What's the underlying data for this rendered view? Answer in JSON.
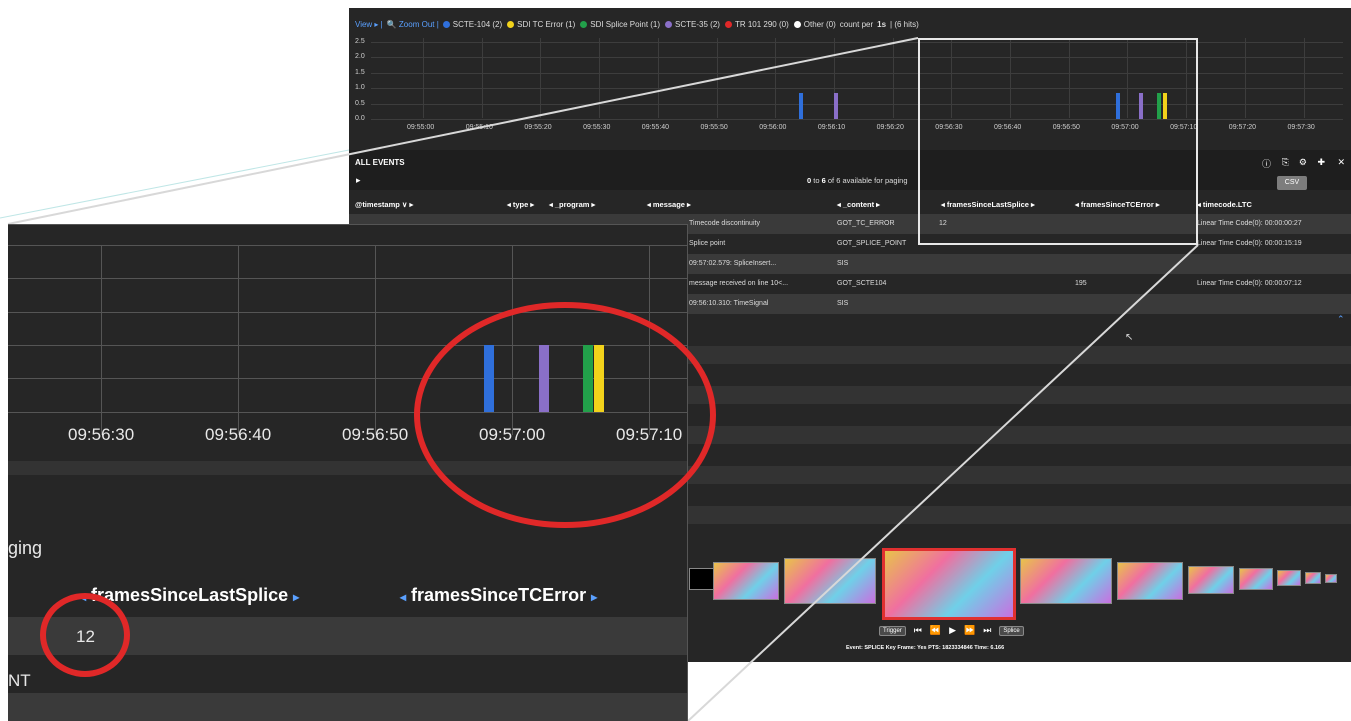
{
  "legend": {
    "view": "View ▸ |",
    "zoom_out": "🔍 Zoom Out |",
    "items": [
      {
        "label": "SCTE-104 (2)",
        "color": "#2f6fdb"
      },
      {
        "label": "SDI TC Error (1)",
        "color": "#f2d21b"
      },
      {
        "label": "SDI Splice Point (1)",
        "color": "#22a04a"
      },
      {
        "label": "SCTE-35 (2)",
        "color": "#8a6fc8"
      },
      {
        "label": "TR 101 290 (0)",
        "color": "#e02828"
      },
      {
        "label": "Other (0)",
        "color": "#ffffff"
      }
    ],
    "count_text": "count per",
    "interval": "1s",
    "hits": "| (6 hits)"
  },
  "chart_data": {
    "type": "bar",
    "y_ticks": [
      "2.5",
      "2.0",
      "1.5",
      "1.0",
      "0.5",
      "0.0"
    ],
    "ylim": [
      0,
      2.5
    ],
    "x_ticks": [
      "09:55:00",
      "09:55:10",
      "09:55:20",
      "09:55:30",
      "09:55:40",
      "09:55:50",
      "09:56:00",
      "09:56:10",
      "09:56:20",
      "09:56:30",
      "09:56:40",
      "09:56:50",
      "09:57:00",
      "09:57:10",
      "09:57:20",
      "09:57:30"
    ],
    "series": [
      {
        "name": "SCTE-104",
        "color": "#2f6fdb",
        "points": [
          {
            "x": "09:56:04",
            "y": 1
          },
          {
            "x": "09:56:58",
            "y": 1
          }
        ]
      },
      {
        "name": "SCTE-35",
        "color": "#8a6fc8",
        "points": [
          {
            "x": "09:56:10",
            "y": 1
          },
          {
            "x": "09:57:02",
            "y": 1
          }
        ]
      },
      {
        "name": "SDI Splice Point",
        "color": "#22a04a",
        "points": [
          {
            "x": "09:57:05",
            "y": 1
          }
        ]
      },
      {
        "name": "SDI TC Error",
        "color": "#f2d21b",
        "points": [
          {
            "x": "09:57:06",
            "y": 1
          }
        ]
      }
    ]
  },
  "events": {
    "title": "ALL EVENTS",
    "paging_from": "0",
    "paging_to": "6",
    "paging_rest": "of 6 available for paging",
    "csv_label": "CSV",
    "columns": [
      "@timestamp ∨ ▸",
      "◂ type ▸",
      "◂ _program ▸",
      "◂ message ▸",
      "◂ _content ▸",
      "◂ framesSinceLastSplice ▸",
      "◂ framesSinceTCError ▸",
      "◂ timecode.LTC"
    ],
    "rows": [
      {
        "message": "Timecode discontinuity",
        "content": "GOT_TC_ERROR",
        "last_splice": "12",
        "tc_error": "",
        "ltc": "Linear Time Code(0):  00:00:00:27"
      },
      {
        "message": "Splice point",
        "content": "GOT_SPLICE_POINT",
        "last_splice": "",
        "tc_error": "",
        "ltc": "Linear Time Code(0):  00:00:15:19"
      },
      {
        "message": "09:57:02.579: SpliceInsert...",
        "content": "SIS",
        "last_splice": "",
        "tc_error": "",
        "ltc": ""
      },
      {
        "message": "message received on line 10<...",
        "content": "GOT_SCTE104",
        "last_splice": "",
        "tc_error": "195",
        "ltc": "Linear Time Code(0):  00:00:07:12"
      },
      {
        "message": "09:56:10.310: TimeSignal",
        "content": "SIS",
        "last_splice": "",
        "tc_error": "",
        "ltc": ""
      }
    ]
  },
  "player": {
    "trigger": "Trigger",
    "splice": "Splice",
    "info": "Event: SPLICE  Key Frame: Yes  PTS: 1823334846  Time: 6.166"
  },
  "inset": {
    "x_ticks": [
      "09:56:30",
      "09:56:40",
      "09:56:50",
      "09:57:00",
      "09:57:10"
    ],
    "paging_fragment": "ging",
    "col_last_splice": "framesSinceLastSplice",
    "col_tc_error": "framesSinceTCError",
    "value": "12",
    "nt_fragment": "NT"
  }
}
